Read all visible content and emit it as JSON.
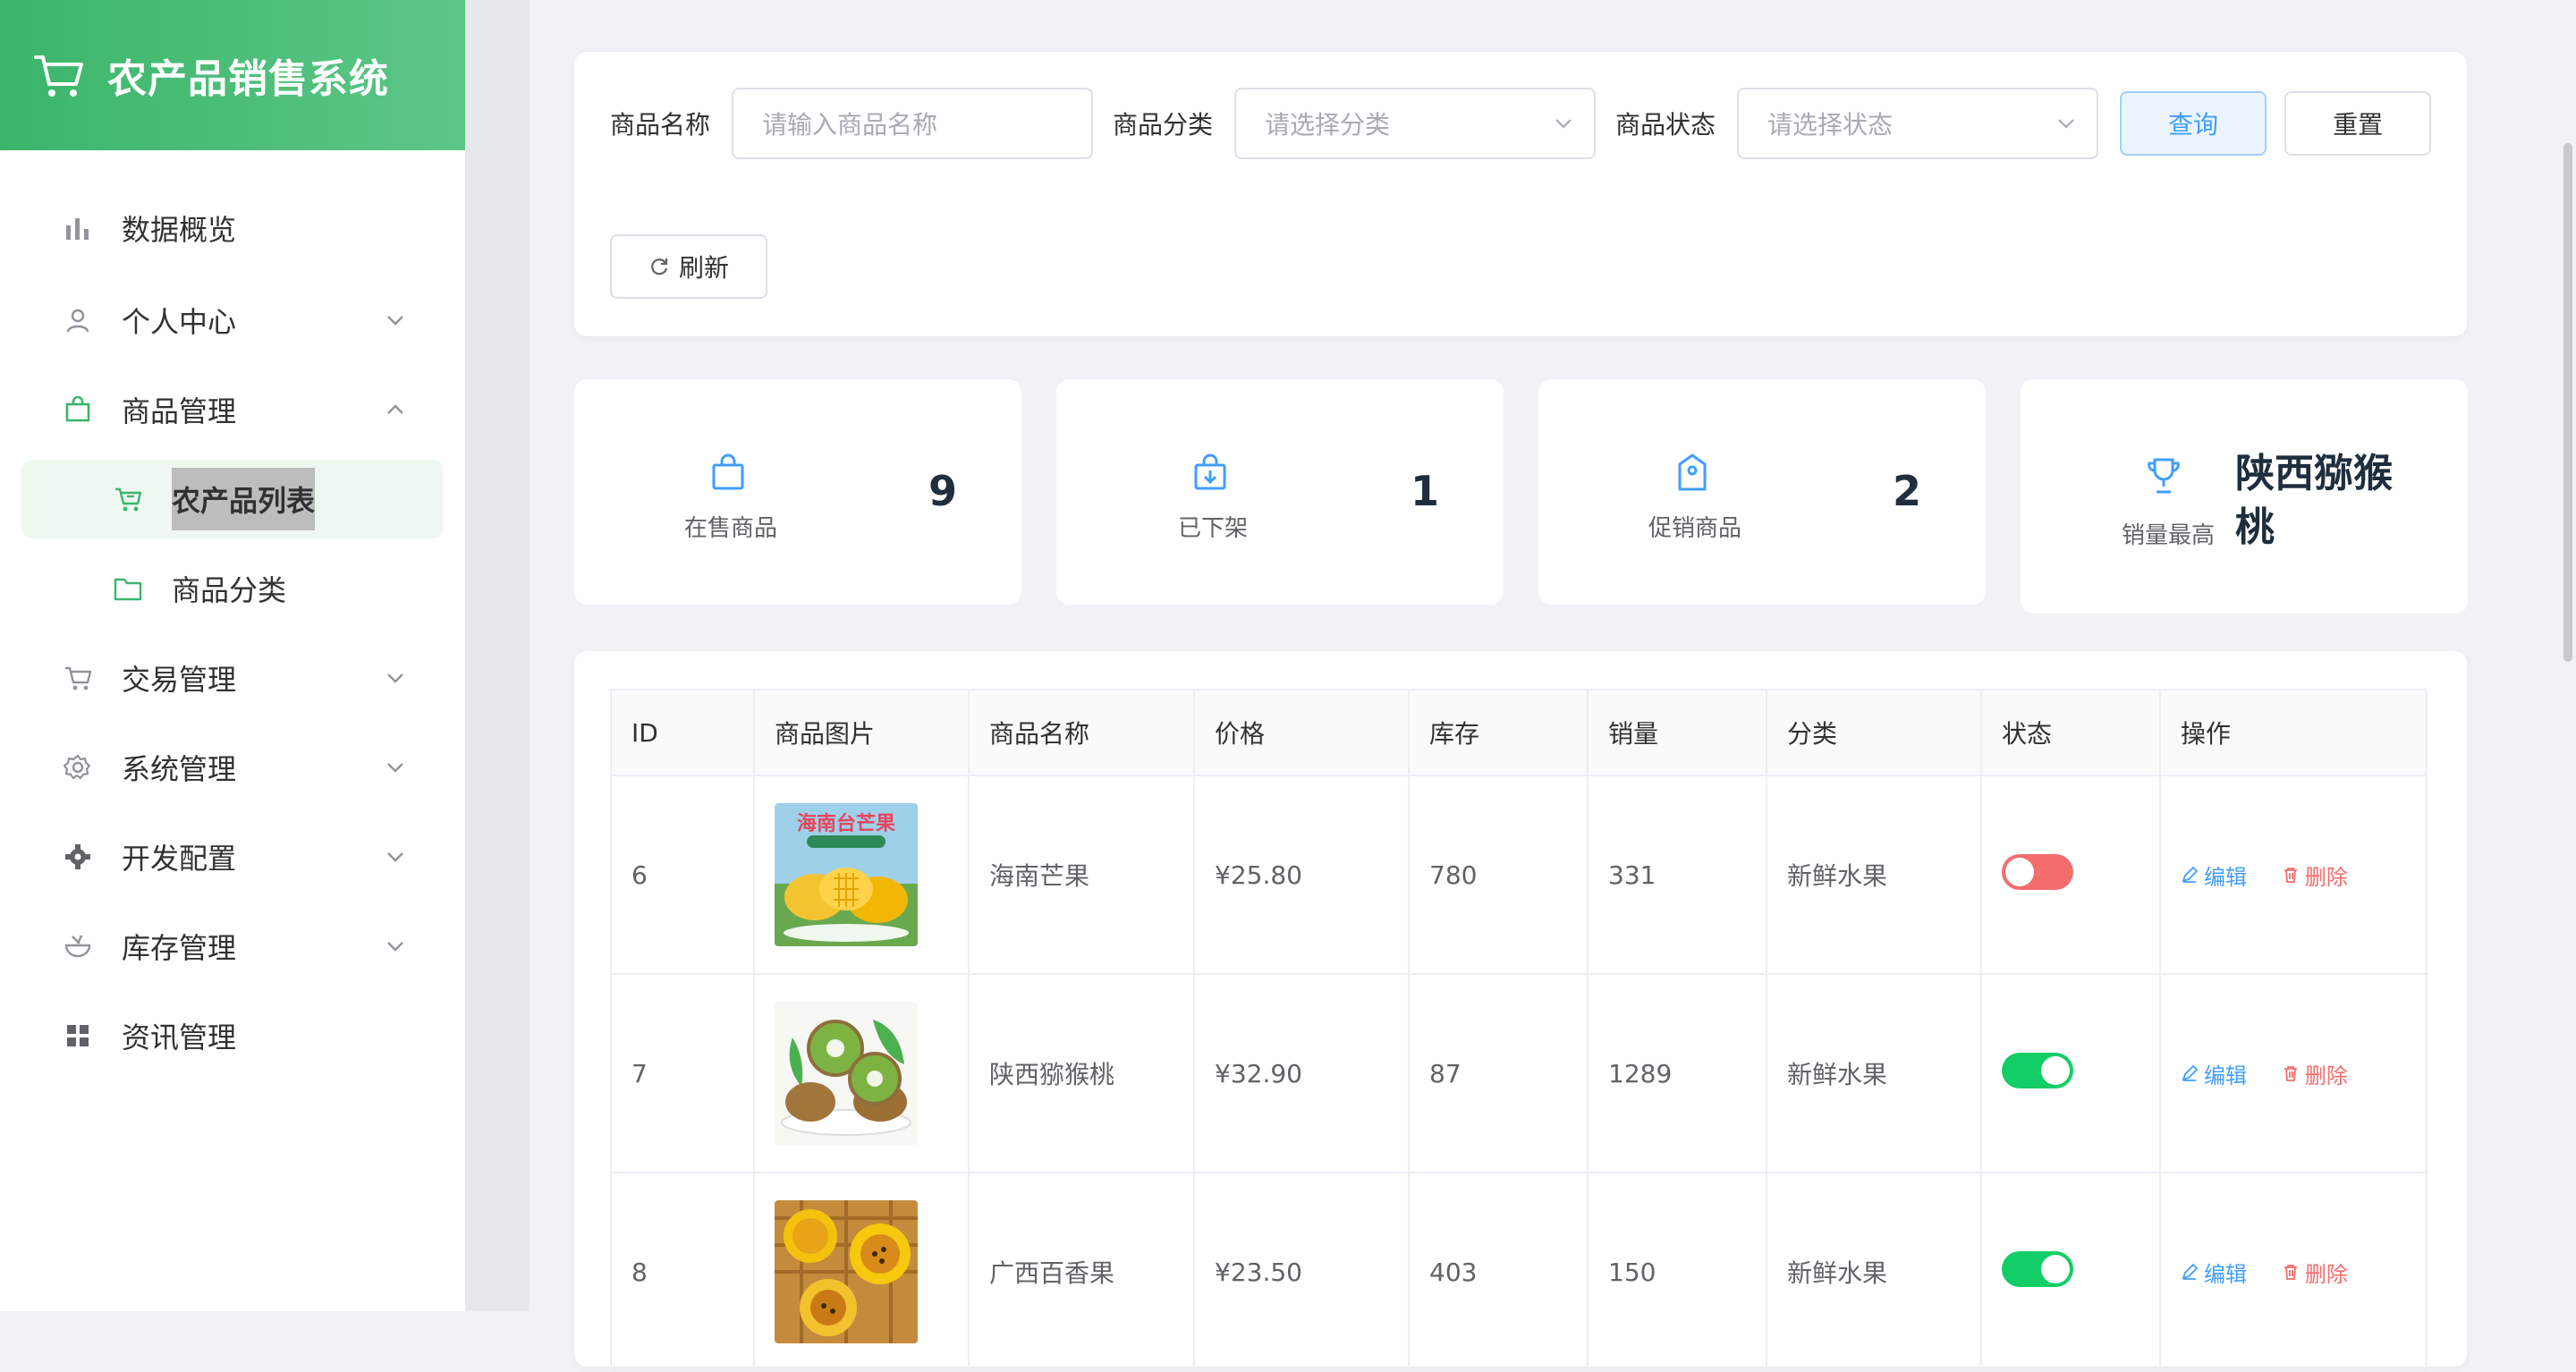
{
  "app": {
    "title": "农产品销售系统"
  },
  "sidebar": {
    "items": [
      {
        "label": "数据概览",
        "icon": "bar-chart-icon"
      },
      {
        "label": "个人中心",
        "icon": "user-icon"
      },
      {
        "label": "商品管理",
        "icon": "bag-icon"
      },
      {
        "label": "农产品列表",
        "icon": "cart-icon"
      },
      {
        "label": "商品分类",
        "icon": "folder-icon"
      },
      {
        "label": "交易管理",
        "icon": "cart-icon"
      },
      {
        "label": "系统管理",
        "icon": "gear-icon"
      },
      {
        "label": "开发配置",
        "icon": "cog-icon"
      },
      {
        "label": "库存管理",
        "icon": "bowl-icon"
      },
      {
        "label": "资讯管理",
        "icon": "grid-icon"
      }
    ]
  },
  "filters": {
    "name_label": "商品名称",
    "name_placeholder": "请输入商品名称",
    "category_label": "商品分类",
    "category_placeholder": "请选择分类",
    "status_label": "商品状态",
    "status_placeholder": "请选择状态",
    "query_button": "查询",
    "reset_button": "重置",
    "refresh_button": "刷新"
  },
  "stats": [
    {
      "label": "在售商品",
      "value": "9",
      "icon": "shopping-bag-icon"
    },
    {
      "label": "已下架",
      "value": "1",
      "icon": "bag-down-icon"
    },
    {
      "label": "促销商品",
      "value": "2",
      "icon": "price-tag-icon"
    },
    {
      "label": "销量最高",
      "value": "陕西猕猴桃",
      "icon": "trophy-icon"
    }
  ],
  "table": {
    "columns": [
      "ID",
      "商品图片",
      "商品名称",
      "价格",
      "库存",
      "销量",
      "分类",
      "状态",
      "操作"
    ],
    "rows": [
      {
        "id": "6",
        "name": "海南芒果",
        "price": "¥25.80",
        "stock": "780",
        "sales": "331",
        "category": "新鲜水果",
        "status": "off",
        "image_text": "海南台芒果"
      },
      {
        "id": "7",
        "name": "陕西猕猴桃",
        "price": "¥32.90",
        "stock": "87",
        "sales": "1289",
        "category": "新鲜水果",
        "status": "on"
      },
      {
        "id": "8",
        "name": "广西百香果",
        "price": "¥23.50",
        "stock": "403",
        "sales": "150",
        "category": "新鲜水果",
        "status": "on"
      }
    ],
    "edit_label": "编辑",
    "delete_label": "删除"
  },
  "colors": {
    "brand_green": "#3bb56b",
    "primary_blue": "#409eff",
    "danger_red": "#f56c6c",
    "switch_on": "#13ce66"
  }
}
